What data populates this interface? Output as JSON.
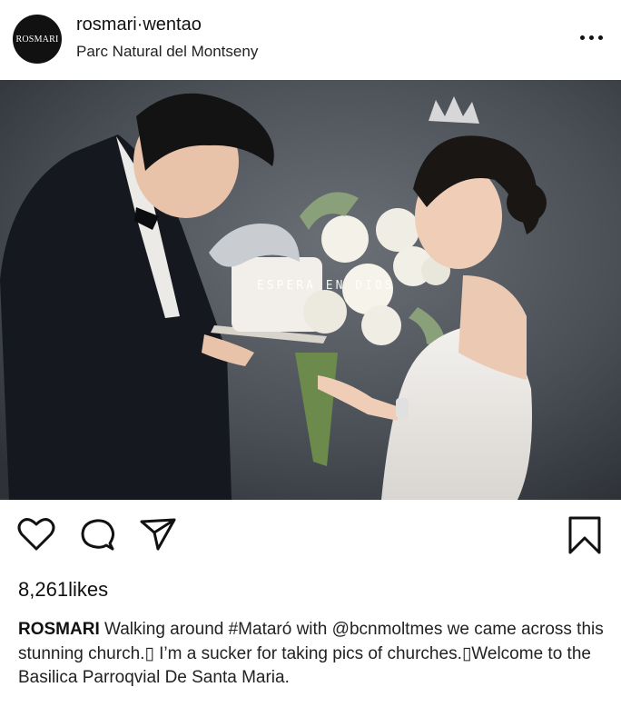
{
  "post": {
    "avatar_text": "ROSMARI",
    "username": "rosmari·wentao",
    "location": "Parc Natural del Montseny",
    "photo_overlay_text": "ESPERA EN DIOS",
    "likes_count": "8,261",
    "likes_label": "likes",
    "caption_author": "ROSMARI",
    "caption_text": " Walking around #Mataró with @bcnmoltmes we came across this stunning church.▯ I’m a sucker for taking pics of churches.▯Welcome to the Basilica Parroqvial De Santa Maria."
  },
  "icons": {
    "more": "more-horizontal-icon",
    "like": "heart-icon",
    "comment": "comment-bubble-icon",
    "share": "paper-plane-icon",
    "save": "bookmark-icon"
  },
  "colors": {
    "text": "#111111",
    "background": "#ffffff",
    "photo_backdrop": "#3a3f45"
  }
}
